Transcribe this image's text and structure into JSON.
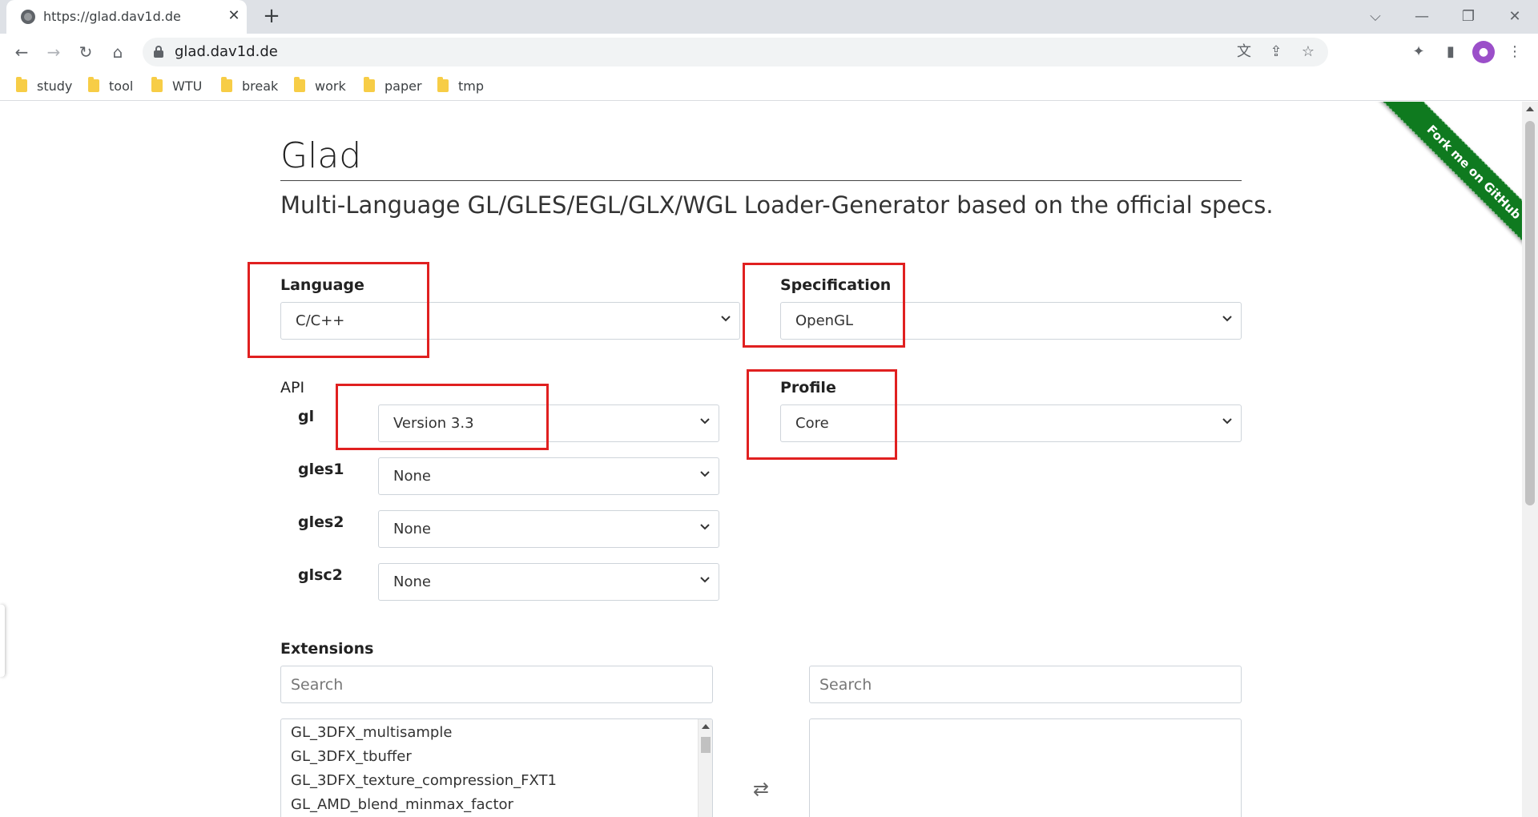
{
  "browser": {
    "tab_title": "https://glad.dav1d.de",
    "tab_close_glyph": "✕",
    "new_tab_glyph": "+",
    "url": "glad.dav1d.de",
    "window_controls": {
      "tablist": "⌵",
      "minimize": "—",
      "restore": "❐",
      "close": "✕"
    },
    "nav": {
      "back": "←",
      "forward": "→",
      "reload": "↻",
      "home": "⌂"
    },
    "toolbar_icons": {
      "translate": "文",
      "share": "⇪",
      "star": "☆",
      "extensions": "✦",
      "sidepanel": "▮",
      "menu": "⋮"
    },
    "bookmarks": [
      "study",
      "tool",
      "WTU",
      "break",
      "work",
      "paper",
      "tmp"
    ]
  },
  "page": {
    "title": "Glad",
    "subtitle": "Multi-Language GL/GLES/EGL/GLX/WGL Loader-Generator based on the official specs.",
    "ribbon": "Fork me on GitHub",
    "language": {
      "label": "Language",
      "value": "C/C++"
    },
    "specification": {
      "label": "Specification",
      "value": "OpenGL"
    },
    "api": {
      "label": "API",
      "rows": [
        {
          "name": "gl",
          "value": "Version 3.3"
        },
        {
          "name": "gles1",
          "value": "None"
        },
        {
          "name": "gles2",
          "value": "None"
        },
        {
          "name": "glsc2",
          "value": "None"
        }
      ]
    },
    "profile": {
      "label": "Profile",
      "value": "Core"
    },
    "extensions": {
      "label": "Extensions",
      "search_left_placeholder": "Search",
      "search_right_placeholder": "Search",
      "available": [
        "GL_3DFX_multisample",
        "GL_3DFX_tbuffer",
        "GL_3DFX_texture_compression_FXT1",
        "GL_AMD_blend_minmax_factor"
      ],
      "swap_glyph": "⇄"
    }
  },
  "colors": {
    "highlight_box": "#e02020",
    "ribbon": "#0f7a1f"
  }
}
